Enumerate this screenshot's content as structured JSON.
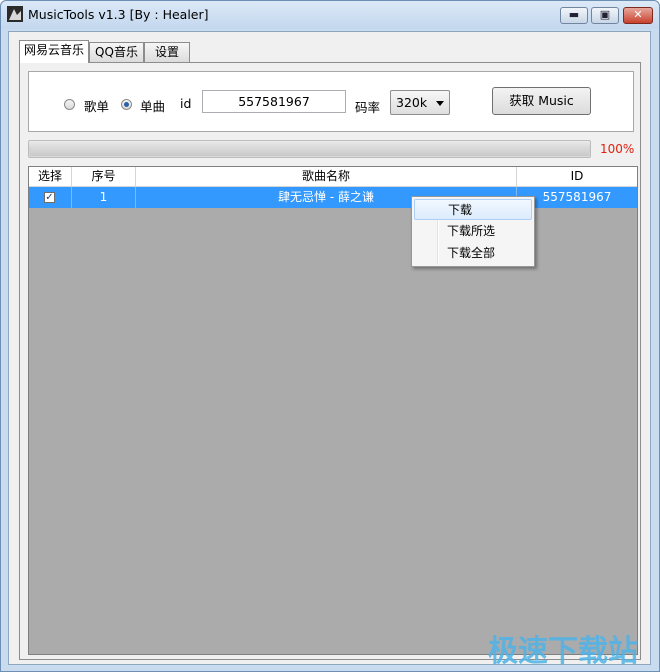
{
  "window": {
    "title": "MusicTools v1.3 [By : Healer]",
    "controls": {
      "minimize": "▬",
      "maximize": "▣",
      "close": "✕"
    }
  },
  "tabs": [
    {
      "label": "网易云音乐",
      "active": true
    },
    {
      "label": "QQ音乐",
      "active": false
    },
    {
      "label": "设置",
      "active": false
    }
  ],
  "search": {
    "radio_playlist": {
      "label": "歌单",
      "checked": false
    },
    "radio_single": {
      "label": "单曲",
      "checked": true
    },
    "id_label": "id",
    "id_value": "557581967",
    "bitrate_label": "码率",
    "bitrate_value": "320k",
    "fetch_button": "获取 Music"
  },
  "progress": {
    "percent_text": "100%",
    "value": 1.0
  },
  "table": {
    "columns": [
      "选择",
      "序号",
      "歌曲名称",
      "ID"
    ],
    "rows": [
      {
        "checked": true,
        "index": "1",
        "name": "肆无忌惮 - 薛之谦",
        "id": "557581967",
        "selected": true
      }
    ]
  },
  "context_menu": {
    "items": [
      "下载",
      "下载所选",
      "下载全部"
    ],
    "highlighted": 0
  },
  "watermark": "极速下载站",
  "colors": {
    "selection": "#3399ff",
    "progress_text": "#e02010",
    "grid_bg": "#ababab",
    "watermark": "#4fb3e8"
  }
}
